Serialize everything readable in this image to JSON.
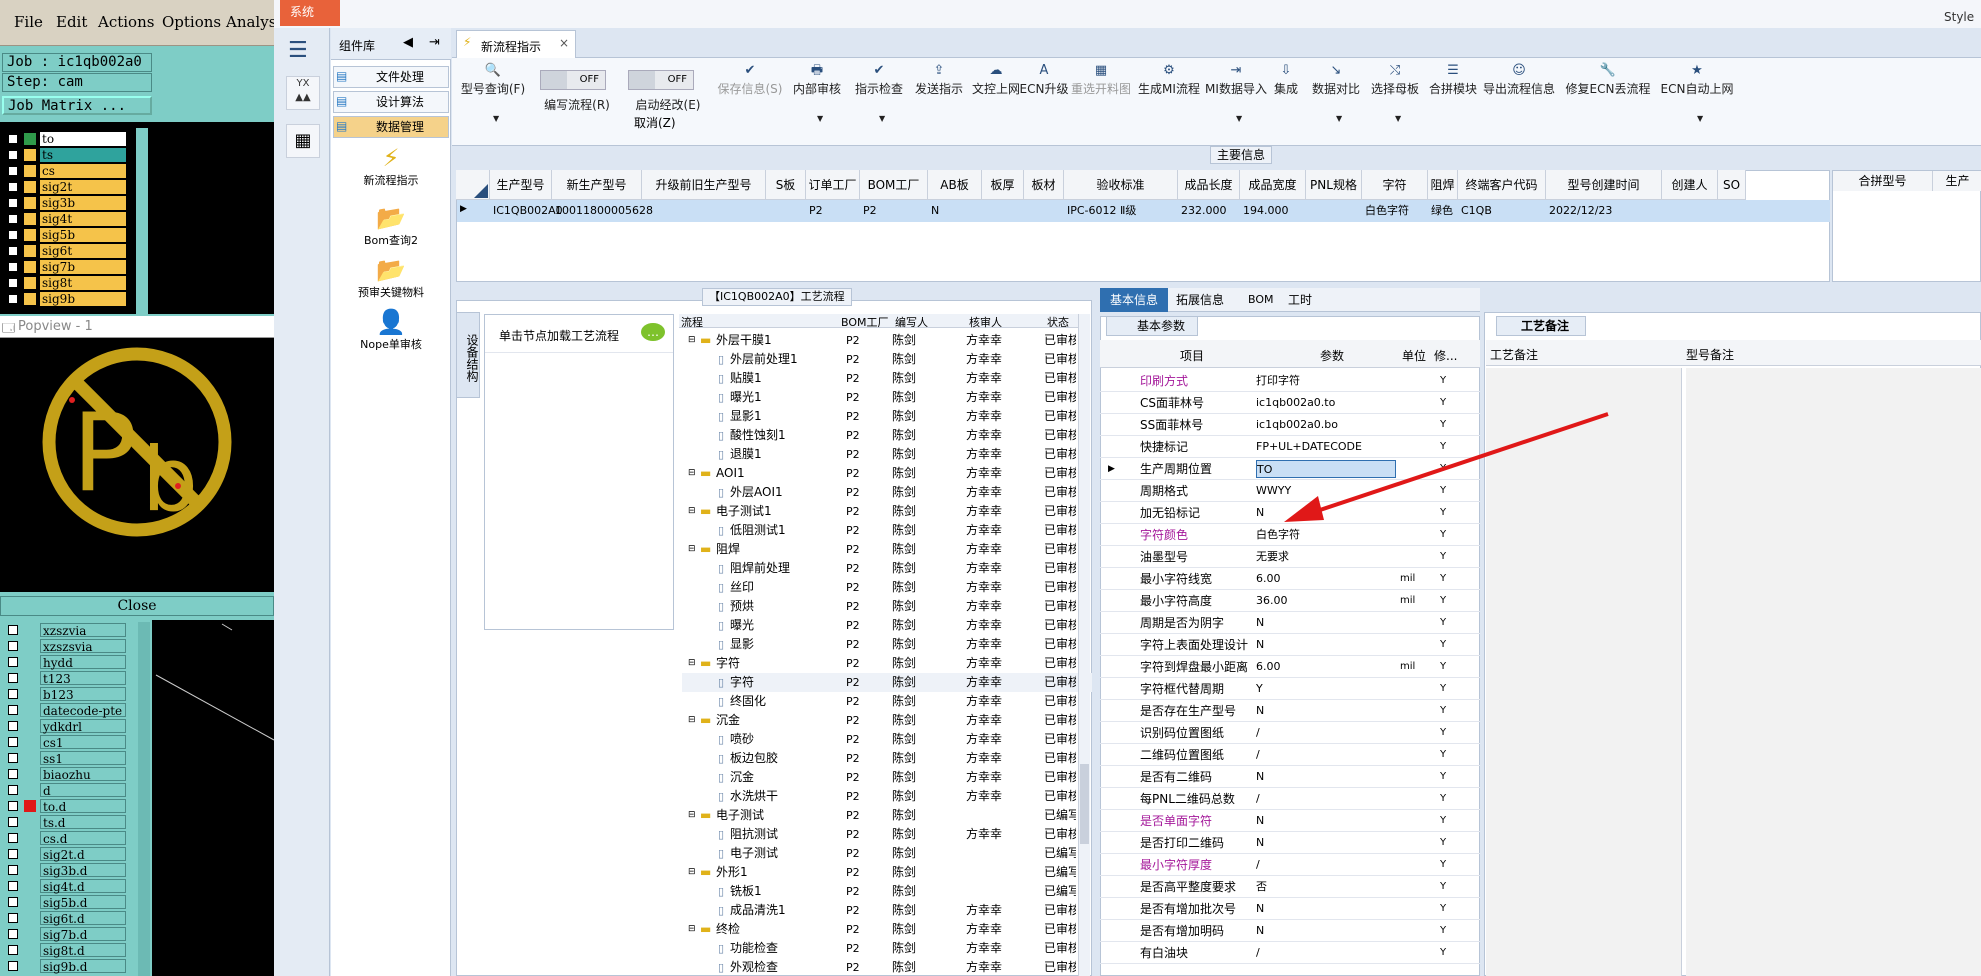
{
  "left_app": {
    "menu": [
      "File",
      "Edit",
      "Actions",
      "Options",
      "Analysi"
    ],
    "job_line": "Job : ic1qb002a0",
    "step_line": "Step: cam",
    "job_matrix": "Job Matrix ...",
    "layers_top": [
      {
        "name": "to",
        "color": "#ffffff",
        "swatch": "#2f9a4a"
      },
      {
        "name": "ts",
        "color": "#2fa39d",
        "swatch": "#f5c34a"
      },
      {
        "name": "cs",
        "color": "#f5c34a",
        "swatch": "#f5c34a"
      },
      {
        "name": "sig2t",
        "color": "#f5c34a",
        "swatch": "#f5c34a"
      },
      {
        "name": "sig3b",
        "color": "#f5c34a",
        "swatch": "#f5c34a"
      },
      {
        "name": "sig4t",
        "color": "#f5c34a",
        "swatch": "#f5c34a"
      },
      {
        "name": "sig5b",
        "color": "#f5c34a",
        "swatch": "#f5c34a"
      },
      {
        "name": "sig6t",
        "color": "#f5c34a",
        "swatch": "#f5c34a"
      },
      {
        "name": "sig7b",
        "color": "#f5c34a",
        "swatch": "#f5c34a"
      },
      {
        "name": "sig8t",
        "color": "#f5c34a",
        "swatch": "#f5c34a"
      },
      {
        "name": "sig9b",
        "color": "#f5c34a",
        "swatch": "#f5c34a"
      }
    ],
    "popview_title": "Popview - 1",
    "close_label": "Close",
    "layers_bottom": [
      "xzszvia",
      "xzszsvia",
      "hydd",
      "t123",
      "b123",
      "datecode-pte",
      "ydkdrl",
      "cs1",
      "ss1",
      "biaozhu",
      "d",
      "to.d",
      "ts.d",
      "cs.d",
      "sig2t.d",
      "sig3b.d",
      "sig4t.d",
      "sig5b.d",
      "sig6t.d",
      "sig7b.d",
      "sig8t.d",
      "sig9b.d"
    ]
  },
  "main": {
    "system_tab": "系统",
    "top_right": "Style",
    "component_lib": "组件库",
    "comp_buttons": [
      "文件处理",
      "设计算法",
      "数据管理"
    ],
    "comp_tools": [
      "新流程指示",
      "Bom查询2",
      "预审关键物料",
      "Nope单审核"
    ],
    "doc_tab": "新流程指示",
    "ribbon": [
      {
        "label": "型号查询(F)",
        "icon": "🔍",
        "dis": false
      },
      {
        "label": "编写流程(R)",
        "icon": "",
        "dis": false
      },
      {
        "label": "启动经改(E)",
        "icon": "",
        "dis": false
      },
      {
        "label": "保存信息(S)",
        "icon": "✔",
        "dis": true
      },
      {
        "label": "内部审核",
        "icon": "🖶",
        "dis": false
      },
      {
        "label": "指示检查",
        "icon": "✔",
        "dis": false
      },
      {
        "label": "发送指示",
        "icon": "⇪",
        "dis": false
      },
      {
        "label": "文控上网",
        "icon": "☁",
        "dis": false
      },
      {
        "label": "ECN升级",
        "icon": "A",
        "dis": false
      },
      {
        "label": "重选开料图",
        "icon": "▦",
        "dis": true
      },
      {
        "label": "生成MI流程",
        "icon": "⚙",
        "dis": false
      },
      {
        "label": "MI数据导入",
        "icon": "⇥",
        "dis": false
      },
      {
        "label": "集成",
        "icon": "⇩",
        "dis": false
      },
      {
        "label": "数据对比",
        "icon": "↘",
        "dis": false
      },
      {
        "label": "选择母板",
        "icon": "⤭",
        "dis": false
      },
      {
        "label": "合拼模块",
        "icon": "☰",
        "dis": false
      },
      {
        "label": "导出流程信息",
        "icon": "☺",
        "dis": false
      },
      {
        "label": "修复ECN丢流程",
        "icon": "🔧",
        "dis": false
      },
      {
        "label": "ECN自动上网",
        "icon": "★",
        "dis": false
      }
    ],
    "cancel_label": "取消(Z)",
    "toggle_off": "OFF",
    "main_info_title": "主要信息",
    "grid_headers": [
      "生产型号",
      "新生产型号",
      "升级前旧生产型号",
      "S板",
      "订单工厂",
      "BOM工厂",
      "AB板",
      "板厚",
      "板材",
      "验收标准",
      "成品长度",
      "成品宽度",
      "PNL规格",
      "字符",
      "阻焊",
      "终端客户代码",
      "型号创建时间",
      "创建人",
      "SO"
    ],
    "grid_row": [
      "IC1QB002A0",
      "10011800005628",
      "",
      "",
      "P2",
      "P2",
      "N",
      "",
      "",
      "IPC-6012 Ⅱ级",
      "232.000",
      "194.000",
      "",
      "白色字符",
      "绿色",
      "C1QB",
      "2022/12/23",
      "",
      ""
    ],
    "grid_right_headers": [
      "合拼型号",
      "生产"
    ],
    "process_panel_title": "【IC1QB002A0】工艺流程",
    "side_tab": "设备结构",
    "load_hint": "单击节点加载工艺流程",
    "tree_headers": [
      "流程",
      "BOM工厂",
      "编写人",
      "核审人",
      "状态"
    ],
    "tree_rows": [
      {
        "lvl": 0,
        "name": "外层干膜1",
        "bom": "P2",
        "w": "陈剑",
        "r": "方幸幸",
        "s": "已审核"
      },
      {
        "lvl": 1,
        "name": "外层前处理1",
        "bom": "P2",
        "w": "陈剑",
        "r": "方幸幸",
        "s": "已审核"
      },
      {
        "lvl": 1,
        "name": "贴膜1",
        "bom": "P2",
        "w": "陈剑",
        "r": "方幸幸",
        "s": "已审核"
      },
      {
        "lvl": 1,
        "name": "曝光1",
        "bom": "P2",
        "w": "陈剑",
        "r": "方幸幸",
        "s": "已审核"
      },
      {
        "lvl": 1,
        "name": "显影1",
        "bom": "P2",
        "w": "陈剑",
        "r": "方幸幸",
        "s": "已审核"
      },
      {
        "lvl": 1,
        "name": "酸性蚀刻1",
        "bom": "P2",
        "w": "陈剑",
        "r": "方幸幸",
        "s": "已审核"
      },
      {
        "lvl": 1,
        "name": "退膜1",
        "bom": "P2",
        "w": "陈剑",
        "r": "方幸幸",
        "s": "已审核"
      },
      {
        "lvl": 0,
        "name": "AOI1",
        "bom": "P2",
        "w": "陈剑",
        "r": "方幸幸",
        "s": "已审核"
      },
      {
        "lvl": 1,
        "name": "外层AOI1",
        "bom": "P2",
        "w": "陈剑",
        "r": "方幸幸",
        "s": "已审核"
      },
      {
        "lvl": 0,
        "name": "电子测试1",
        "bom": "P2",
        "w": "陈剑",
        "r": "方幸幸",
        "s": "已审核"
      },
      {
        "lvl": 1,
        "name": "低阻测试1",
        "bom": "P2",
        "w": "陈剑",
        "r": "方幸幸",
        "s": "已审核"
      },
      {
        "lvl": 0,
        "name": "阻焊",
        "bom": "P2",
        "w": "陈剑",
        "r": "方幸幸",
        "s": "已审核"
      },
      {
        "lvl": 1,
        "name": "阻焊前处理",
        "bom": "P2",
        "w": "陈剑",
        "r": "方幸幸",
        "s": "已审核"
      },
      {
        "lvl": 1,
        "name": "丝印",
        "bom": "P2",
        "w": "陈剑",
        "r": "方幸幸",
        "s": "已审核"
      },
      {
        "lvl": 1,
        "name": "预烘",
        "bom": "P2",
        "w": "陈剑",
        "r": "方幸幸",
        "s": "已审核"
      },
      {
        "lvl": 1,
        "name": "曝光",
        "bom": "P2",
        "w": "陈剑",
        "r": "方幸幸",
        "s": "已审核"
      },
      {
        "lvl": 1,
        "name": "显影",
        "bom": "P2",
        "w": "陈剑",
        "r": "方幸幸",
        "s": "已审核"
      },
      {
        "lvl": 0,
        "name": "字符",
        "bom": "P2",
        "w": "陈剑",
        "r": "方幸幸",
        "s": "已审核"
      },
      {
        "lvl": 1,
        "name": "字符",
        "bom": "P2",
        "w": "陈剑",
        "r": "方幸幸",
        "s": "已审核"
      },
      {
        "lvl": 1,
        "name": "终固化",
        "bom": "P2",
        "w": "陈剑",
        "r": "方幸幸",
        "s": "已审核"
      },
      {
        "lvl": 0,
        "name": "沉金",
        "bom": "P2",
        "w": "陈剑",
        "r": "方幸幸",
        "s": "已审核"
      },
      {
        "lvl": 1,
        "name": "喷砂",
        "bom": "P2",
        "w": "陈剑",
        "r": "方幸幸",
        "s": "已审核"
      },
      {
        "lvl": 1,
        "name": "板边包胶",
        "bom": "P2",
        "w": "陈剑",
        "r": "方幸幸",
        "s": "已审核"
      },
      {
        "lvl": 1,
        "name": "沉金",
        "bom": "P2",
        "w": "陈剑",
        "r": "方幸幸",
        "s": "已审核"
      },
      {
        "lvl": 1,
        "name": "水洗烘干",
        "bom": "P2",
        "w": "陈剑",
        "r": "方幸幸",
        "s": "已审核"
      },
      {
        "lvl": 0,
        "name": "电子测试",
        "bom": "P2",
        "w": "陈剑",
        "r": "",
        "s": "已编写"
      },
      {
        "lvl": 1,
        "name": "阻抗测试",
        "bom": "P2",
        "w": "陈剑",
        "r": "方幸幸",
        "s": "已审核"
      },
      {
        "lvl": 1,
        "name": "电子测试",
        "bom": "P2",
        "w": "陈剑",
        "r": "",
        "s": "已编写"
      },
      {
        "lvl": 0,
        "name": "外形1",
        "bom": "P2",
        "w": "陈剑",
        "r": "",
        "s": "已编写"
      },
      {
        "lvl": 1,
        "name": "铣板1",
        "bom": "P2",
        "w": "陈剑",
        "r": "",
        "s": "已编写"
      },
      {
        "lvl": 1,
        "name": "成品清洗1",
        "bom": "P2",
        "w": "陈剑",
        "r": "方幸幸",
        "s": "已审核"
      },
      {
        "lvl": 0,
        "name": "终检",
        "bom": "P2",
        "w": "陈剑",
        "r": "方幸幸",
        "s": "已审核"
      },
      {
        "lvl": 1,
        "name": "功能检查",
        "bom": "P2",
        "w": "陈剑",
        "r": "方幸幸",
        "s": "已审核"
      },
      {
        "lvl": 1,
        "name": "外观检查",
        "bom": "P2",
        "w": "陈剑",
        "r": "方幸幸",
        "s": "已审核"
      }
    ],
    "info_tabs": [
      "基本信息",
      "拓展信息",
      "BOM",
      "工时"
    ],
    "basic_param_title": "基本参数",
    "param_headers": [
      "项目",
      "参数",
      "单位",
      "修..."
    ],
    "params": [
      {
        "name": "印刷方式",
        "val": "打印字符",
        "unit": "",
        "mod": "Y",
        "pink": true
      },
      {
        "name": "CS面菲林号",
        "val": "ic1qb002a0.to",
        "unit": "",
        "mod": "Y",
        "pink": false
      },
      {
        "name": "SS面菲林号",
        "val": "ic1qb002a0.bo",
        "unit": "",
        "mod": "Y",
        "pink": false
      },
      {
        "name": "快捷标记",
        "val": "FP+UL+DATECODE",
        "unit": "",
        "mod": "Y",
        "pink": false
      },
      {
        "name": "生产周期位置",
        "val": "TO",
        "unit": "",
        "mod": "Y",
        "pink": false
      },
      {
        "name": "周期格式",
        "val": "WWYY",
        "unit": "",
        "mod": "Y",
        "pink": false
      },
      {
        "name": "加无铅标记",
        "val": "N",
        "unit": "",
        "mod": "Y",
        "pink": false
      },
      {
        "name": "字符颜色",
        "val": "白色字符",
        "unit": "",
        "mod": "Y",
        "pink": true
      },
      {
        "name": "油墨型号",
        "val": "无要求",
        "unit": "",
        "mod": "Y",
        "pink": false
      },
      {
        "name": "最小字符线宽",
        "val": "6.00",
        "unit": "mil",
        "mod": "Y",
        "pink": false
      },
      {
        "name": "最小字符高度",
        "val": "36.00",
        "unit": "mil",
        "mod": "Y",
        "pink": false
      },
      {
        "name": "周期是否为阴字",
        "val": "N",
        "unit": "",
        "mod": "Y",
        "pink": false
      },
      {
        "name": "字符上表面处理设计",
        "val": "N",
        "unit": "",
        "mod": "Y",
        "pink": false
      },
      {
        "name": "字符到焊盘最小距离",
        "val": "6.00",
        "unit": "mil",
        "mod": "Y",
        "pink": false
      },
      {
        "name": "字符框代替周期",
        "val": "Y",
        "unit": "",
        "mod": "Y",
        "pink": false
      },
      {
        "name": "是否存在生产型号",
        "val": "N",
        "unit": "",
        "mod": "Y",
        "pink": false
      },
      {
        "name": "识别码位置图纸",
        "val": "/",
        "unit": "",
        "mod": "Y",
        "pink": false
      },
      {
        "name": "二维码位置图纸",
        "val": "/",
        "unit": "",
        "mod": "Y",
        "pink": false
      },
      {
        "name": "是否有二维码",
        "val": "N",
        "unit": "",
        "mod": "Y",
        "pink": false
      },
      {
        "name": "每PNL二维码总数",
        "val": "/",
        "unit": "",
        "mod": "Y",
        "pink": false
      },
      {
        "name": "是否单面字符",
        "val": "N",
        "unit": "",
        "mod": "Y",
        "pink": true
      },
      {
        "name": "是否打印二维码",
        "val": "N",
        "unit": "",
        "mod": "Y",
        "pink": false
      },
      {
        "name": "最小字符厚度",
        "val": "/",
        "unit": "",
        "mod": "Y",
        "pink": true
      },
      {
        "name": "是否高平整度要求",
        "val": "否",
        "unit": "",
        "mod": "Y",
        "pink": false
      },
      {
        "name": "是否有增加批次号",
        "val": "N",
        "unit": "",
        "mod": "Y",
        "pink": false
      },
      {
        "name": "是否有增加明码",
        "val": "N",
        "unit": "",
        "mod": "Y",
        "pink": false
      },
      {
        "name": "有白油块",
        "val": "/",
        "unit": "",
        "mod": "Y",
        "pink": false
      }
    ],
    "remark_title": "工艺备注",
    "remark_headers": [
      "工艺备注",
      "型号备注"
    ]
  },
  "colors": {
    "accent": "#2f6fb0",
    "pink": "#a4189a",
    "arrow": "#e01818"
  }
}
